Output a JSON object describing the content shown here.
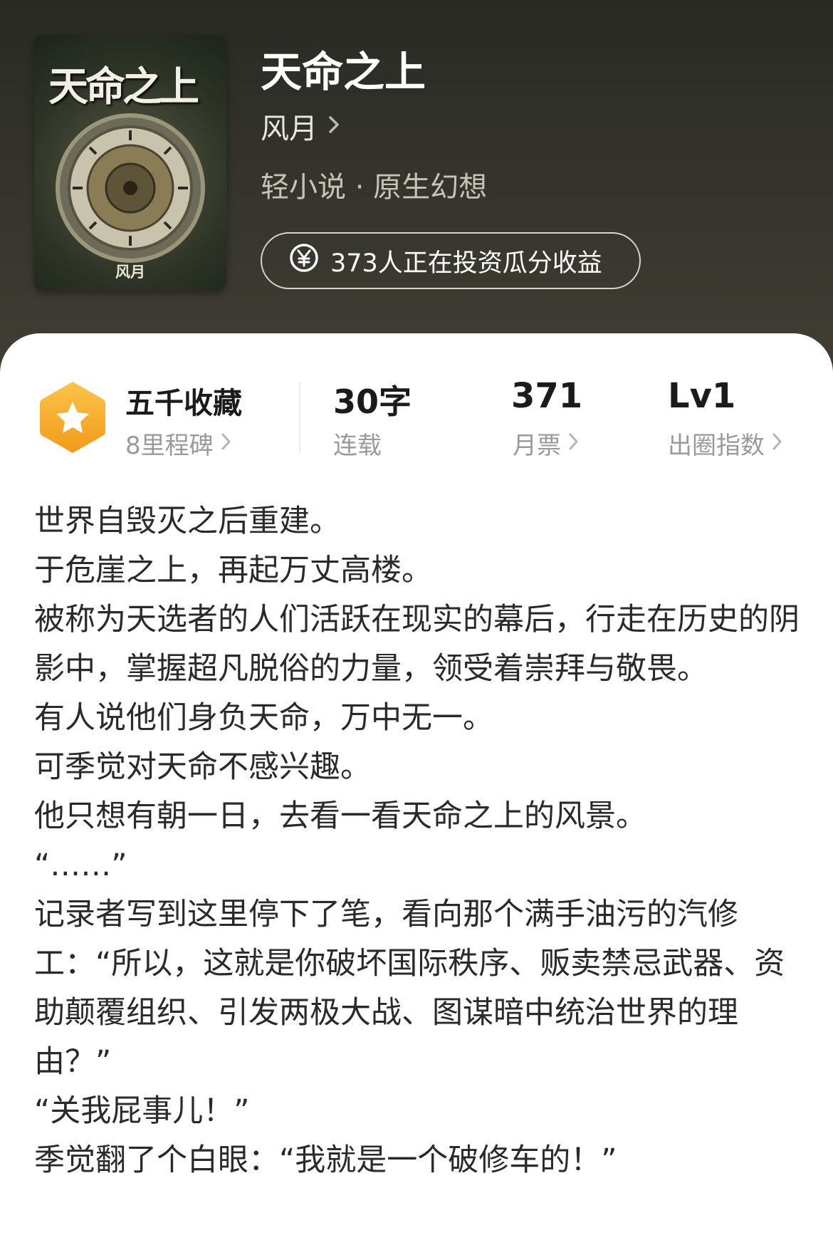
{
  "book": {
    "title": "天命之上",
    "author": "风月",
    "tags": "轻小说 · 原生幻想",
    "invest_text": "373人正在投资瓜分收益",
    "cover": {
      "title": "天命之上",
      "author": "风月"
    }
  },
  "stats": {
    "badge": {
      "title": "五千收藏",
      "subtitle": "8里程碑"
    },
    "words": {
      "value": "30字",
      "label": "连载"
    },
    "monthly_votes": {
      "value": "371",
      "label": "月票"
    },
    "level": {
      "value": "Lv1",
      "label": "出圈指数"
    }
  },
  "description": [
    "世界自毁灭之后重建。",
    "于危崖之上，再起万丈高楼。",
    "被称为天选者的人们活跃在现实的幕后，行走在历史的阴影中，掌握超凡脱俗的力量，领受着崇拜与敬畏。",
    "有人说他们身负天命，万中无一。",
    "可季觉对天命不感兴趣。",
    "他只想有朝一日，去看一看天命之上的风景。",
    "“……”",
    "记录者写到这里停下了笔，看向那个满手油污的汽修工：“所以，这就是你破坏国际秩序、贩卖禁忌武器、资助颠覆组织、引发两极大战、图谋暗中统治世界的理由？”",
    "“关我屁事儿！”",
    "季觉翻了个白眼：“我就是一个破修车的！”"
  ],
  "icons": {
    "author_chevron": "chevron-right-icon",
    "invest": "yen-coin-icon",
    "badge": "star-hexagon-badge-icon"
  },
  "colors": {
    "header_bg": "#33332c",
    "badge_orange": "#f5a623",
    "stat_label": "#9a9a9a",
    "text": "#2a2a2a"
  }
}
